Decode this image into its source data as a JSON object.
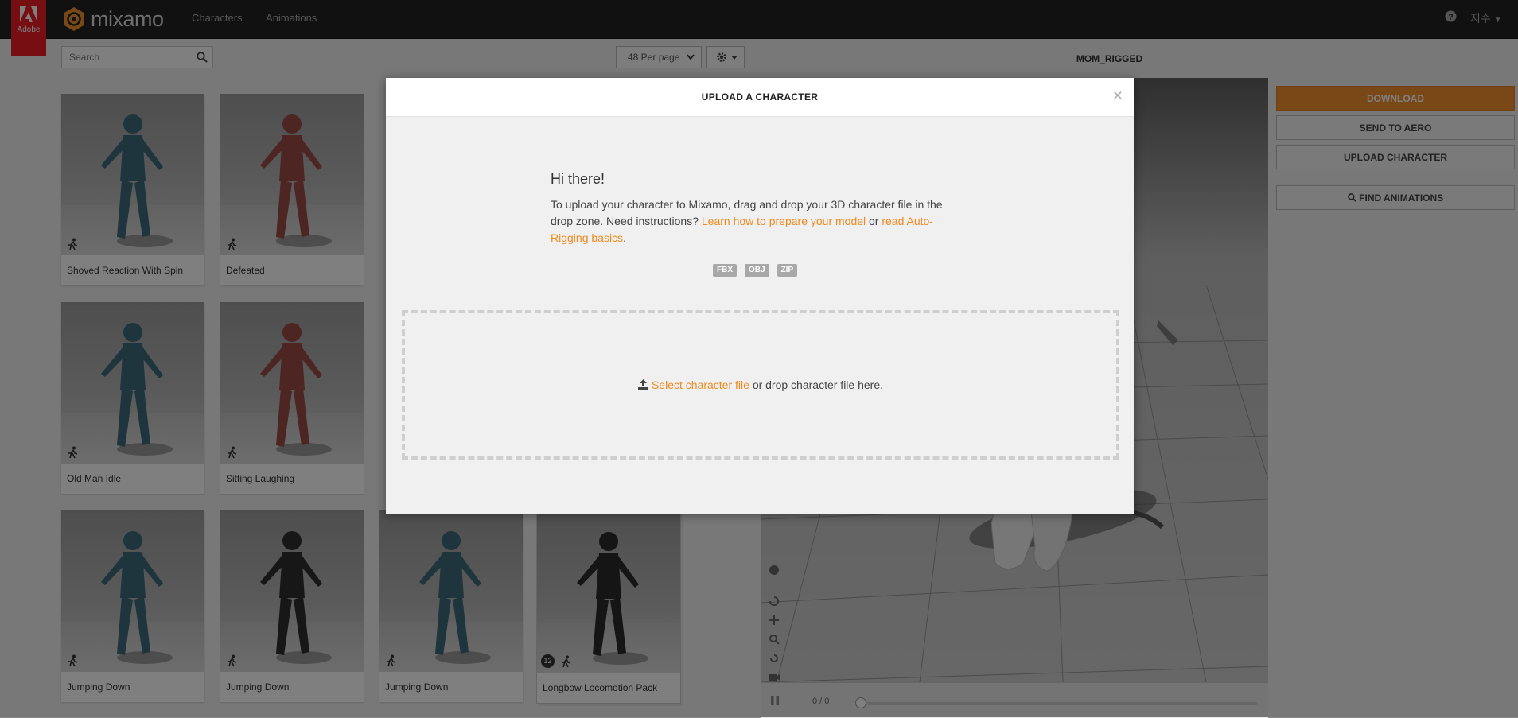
{
  "nav": {
    "adobe_label": "Adobe",
    "brand": "mixamo",
    "characters": "Characters",
    "animations": "Animations",
    "user": "지수"
  },
  "toolbar": {
    "search_placeholder": "Search",
    "per_page": "48 Per page"
  },
  "cards": [
    {
      "label": "Shoved Reaction With Spin",
      "color": "#3f6a7b"
    },
    {
      "label": "Defeated",
      "color": "#9b4b45"
    },
    {
      "label": "Old Man Idle",
      "color": "#3f6a7b"
    },
    {
      "label": "Sitting Laughing",
      "color": "#9b4b45"
    },
    {
      "label": "Jumping Down",
      "color": "#3f6a7b"
    },
    {
      "label": "Jumping Down",
      "color": "#2f2f2f"
    },
    {
      "label": "Jumping Down",
      "color": "#3f6a7b"
    },
    {
      "label": "Longbow Locomotion Pack",
      "color": "#2b2b2b",
      "pack_count": "12"
    }
  ],
  "viewer": {
    "title": "MOM_RIGGED",
    "frame": "0 / 0",
    "progress": 0
  },
  "sidebar": {
    "download": "DOWNLOAD",
    "send_to_aero": "SEND TO AERO",
    "upload_character": "UPLOAD CHARACTER",
    "find_animations": "FIND ANIMATIONS"
  },
  "modal": {
    "title": "UPLOAD A CHARACTER",
    "close": "×",
    "greeting": "Hi there!",
    "instructions_text": "To upload your character to Mixamo, drag and drop your 3D character file in the drop zone. Need instructions?",
    "link_prepare": "Learn how to prepare your model",
    "or": "or",
    "link_autorig": "read Auto-Rigging basics",
    "formats": [
      "FBX",
      "OBJ",
      "ZIP"
    ],
    "select_file": "Select character file",
    "drop_text": "or drop character file here."
  },
  "colors": {
    "accent": "#f4912e",
    "link": "#ef8a1f",
    "adobe_red": "#ec1c24"
  }
}
